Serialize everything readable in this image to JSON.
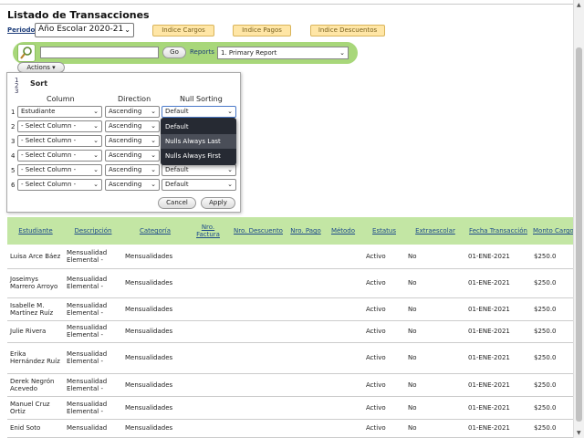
{
  "page": {
    "title": "Listado de Transacciones"
  },
  "periodo": {
    "label": "Periodo",
    "value": "Año Escolar 2020-21"
  },
  "tabs": [
    "Indice Cargos",
    "Indice Pagos",
    "Indice Descuentos"
  ],
  "search": {
    "go_label": "Go",
    "reports_label": "Reports",
    "report_value": "1. Primary Report"
  },
  "actions_label": "Actions",
  "sort_panel": {
    "title": "Sort",
    "headers": {
      "column": "Column",
      "direction": "Direction",
      "null_sorting": "Null Sorting"
    },
    "rows": [
      {
        "num": "1",
        "column": "Estudiante",
        "direction": "Ascending",
        "nulls": "Default"
      },
      {
        "num": "2",
        "column": "- Select Column -",
        "direction": "Ascending",
        "nulls": ""
      },
      {
        "num": "3",
        "column": "- Select Column -",
        "direction": "Ascending",
        "nulls": ""
      },
      {
        "num": "4",
        "column": "- Select Column -",
        "direction": "Ascending",
        "nulls": ""
      },
      {
        "num": "5",
        "column": "- Select Column -",
        "direction": "Ascending",
        "nulls": "Default"
      },
      {
        "num": "6",
        "column": "- Select Column -",
        "direction": "Ascending",
        "nulls": "Default"
      }
    ],
    "cancel_label": "Cancel",
    "apply_label": "Apply",
    "dropdown_options": [
      "Default",
      "Nulls Always Last",
      "Nulls Always First"
    ],
    "dropdown_highlighted": "Nulls Always Last"
  },
  "table": {
    "columns": [
      "Estudiante",
      "Descripción",
      "Categoría",
      "Nro. Factura",
      "Nro. Descuento",
      "Nro. Pago",
      "Método",
      "Estatus",
      "Extraescolar",
      "Fecha Transacción",
      "Monto Cargo"
    ],
    "rows": [
      [
        "Luisa Arce Báez",
        "Mensualidad Elemental -",
        "Mensualidades",
        "",
        "",
        "",
        "",
        "Activo",
        "No",
        "01-ENE-2021",
        "$250.0"
      ],
      [
        "Joseimys Marrero Arroyo",
        "Mensualidad Elemental -",
        "Mensualidades",
        "",
        "",
        "",
        "",
        "Activo",
        "No",
        "01-ENE-2021",
        "$250.0"
      ],
      [
        "Isabelle M. Martínez Ruíz",
        "Mensualidad Elemental -",
        "Mensualidades",
        "",
        "",
        "",
        "",
        "Activo",
        "No",
        "01-ENE-2021",
        "$250.0"
      ],
      [
        "Julie Rivera",
        "Mensualidad Elemental -",
        "Mensualidades",
        "",
        "",
        "",
        "",
        "Activo",
        "No",
        "01-ENE-2021",
        "$250.0"
      ],
      [
        "Erika Hernández Ruíz",
        "Mensualidad Elemental -",
        "Mensualidades",
        "",
        "",
        "",
        "",
        "Activo",
        "No",
        "01-ENE-2021",
        "$250.0"
      ],
      [
        "Derek Negrón Acevedo",
        "Mensualidad Elemental -",
        "Mensualidades",
        "",
        "",
        "",
        "",
        "Activo",
        "No",
        "01-ENE-2021",
        "$250.0"
      ],
      [
        "Manuel Cruz Ortiz",
        "Mensualidad Elemental -",
        "Mensualidades",
        "",
        "",
        "",
        "",
        "Activo",
        "No",
        "01-ENE-2021",
        "$250.0"
      ],
      [
        "Enid Soto",
        "Mensualidad",
        "Mensualidades",
        "",
        "",
        "",
        "",
        "Activo",
        "No",
        "01-ENE-2021",
        "$250.0"
      ]
    ]
  },
  "colors": {
    "green_bar": "#a8d77a",
    "table_header": "#c3e6a4",
    "orange_btn": "#ffe6a6",
    "link_blue": "#1d4b8a",
    "dropdown_bg": "#262a33"
  }
}
